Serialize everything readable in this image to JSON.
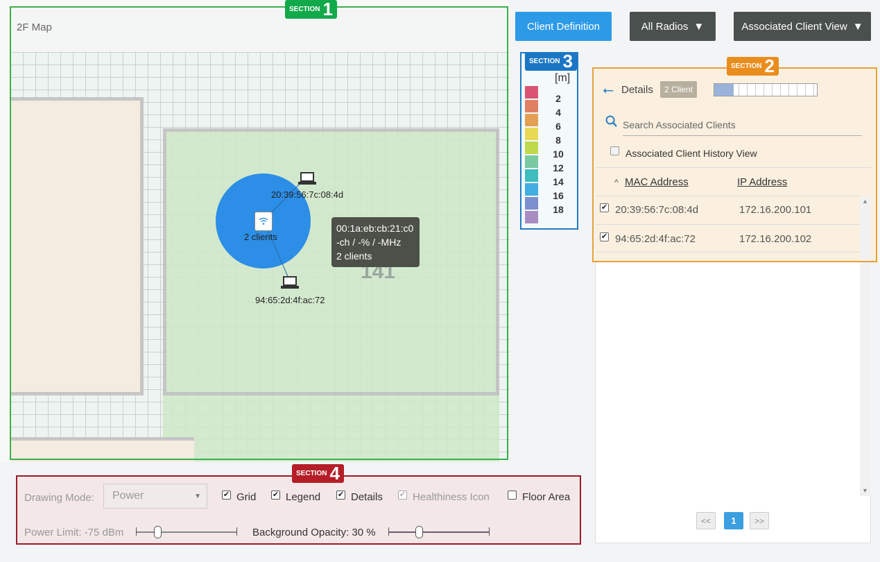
{
  "section_tags": [
    {
      "text": "SECTION",
      "number": "1"
    },
    {
      "text": "SECTION",
      "number": "2"
    },
    {
      "text": "SECTION",
      "number": "3"
    },
    {
      "text": "SECTION",
      "number": "4"
    }
  ],
  "map": {
    "title": "2F Map",
    "room_number": "141",
    "ap_label": "2 clients",
    "clients": [
      {
        "mac": "20:39:56:7c:08:4d"
      },
      {
        "mac": "94:65:2d:4f:ac:72"
      }
    ],
    "tooltip": {
      "line1": "00:1a:eb:cb:21:c0",
      "line2": "-ch / -% / -MHz",
      "line3": "2 clients"
    }
  },
  "toolbar": {
    "client_definition": "Client Definition",
    "all_radios": "All Radios",
    "view_select": "Associated Client View"
  },
  "legend": {
    "unit": "[m]",
    "colors": [
      "#d95470",
      "#e08063",
      "#e3a055",
      "#e8d956",
      "#bfd94c",
      "#79c9a1",
      "#3dbdbd",
      "#43aee0",
      "#7b8fcf",
      "#a98cc3"
    ],
    "values": [
      "2",
      "4",
      "6",
      "8",
      "10",
      "12",
      "14",
      "16",
      "18"
    ]
  },
  "panel": {
    "details_label": "Details",
    "client_count_badge": "2 Client",
    "search_placeholder": "Search Associated Clients",
    "history_label": "Associated Client History View",
    "history_checked": false,
    "columns": {
      "mac": "MAC Address",
      "ip": "IP Address"
    },
    "sort_indicator": "^",
    "rows": [
      {
        "mac": "20:39:56:7c:08:4d",
        "ip": "172.16.200.101",
        "checked": true
      },
      {
        "mac": "94:65:2d:4f:ac:72",
        "ip": "172.16.200.102",
        "checked": true
      }
    ],
    "pagination": {
      "prev": "<<",
      "page": "1",
      "next": ">>"
    }
  },
  "controls": {
    "drawing_mode_label": "Drawing Mode:",
    "drawing_mode_value": "Power",
    "grid_label": "Grid",
    "grid_checked": true,
    "legend_label": "Legend",
    "legend_checked": true,
    "details_label": "Details",
    "details_checked": true,
    "health_label": "Healthiness Icon",
    "health_checked": true,
    "floor_label": "Floor Area",
    "floor_checked": false,
    "power_limit_label": "Power Limit: -75 dBm",
    "opacity_label": "Background Opacity: 30 %"
  }
}
